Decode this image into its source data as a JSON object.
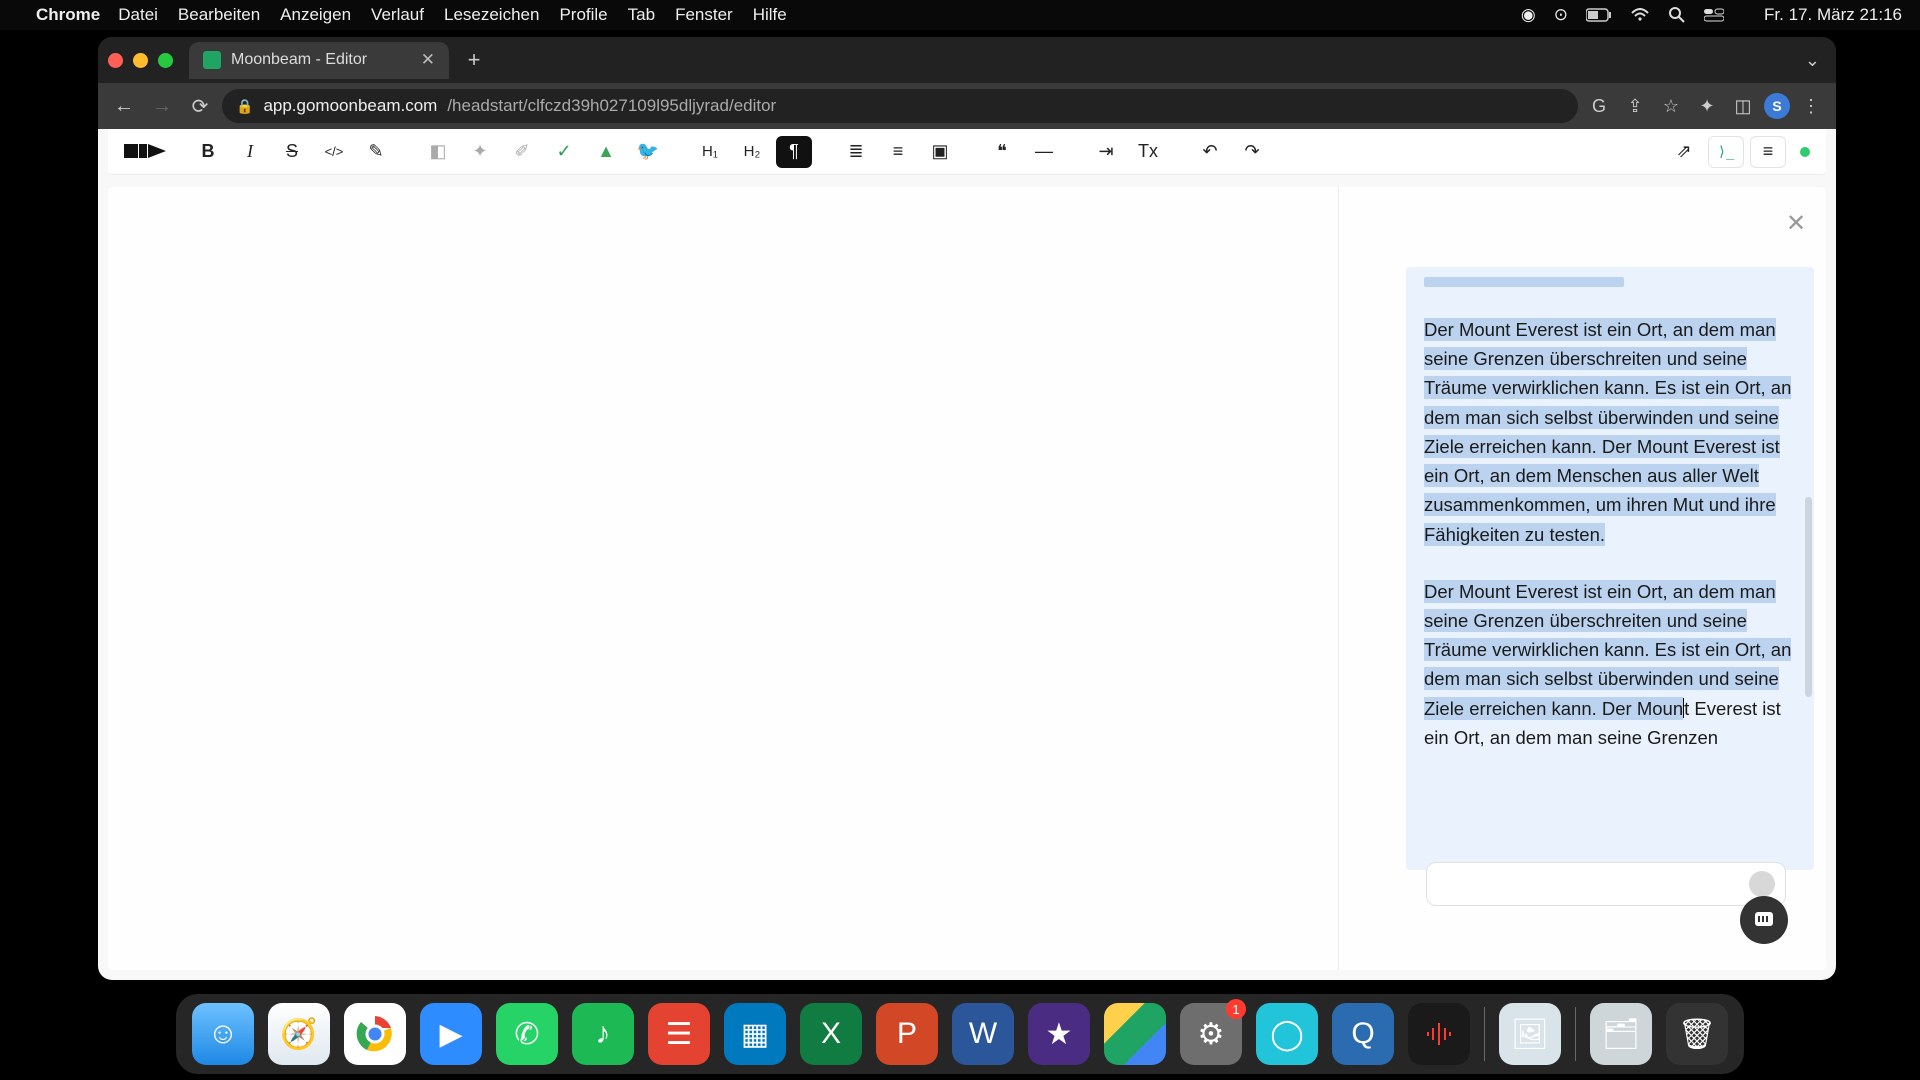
{
  "menubar": {
    "app_name": "Chrome",
    "items": [
      "Datei",
      "Bearbeiten",
      "Anzeigen",
      "Verlauf",
      "Lesezeichen",
      "Profile",
      "Tab",
      "Fenster",
      "Hilfe"
    ],
    "clock": "Fr. 17. März  21:16"
  },
  "browser": {
    "tab_title": "Moonbeam - Editor",
    "close_glyph": "✕",
    "newtab_glyph": "+",
    "chevron_glyph": "⌄",
    "nav": {
      "back": "←",
      "fwd": "→",
      "reload": "⟳"
    },
    "url_host": "app.gomoonbeam.com",
    "url_path": "/headstart/clfczd39h027109l95dljyrad/editor",
    "lock_glyph": "🔒",
    "avatar_initial": "S",
    "ext_glyphs": {
      "google": "G",
      "share": "⇪",
      "star": "☆",
      "puzzle": "✦",
      "panel": "◫",
      "menu": "⋮"
    }
  },
  "toolbar": {
    "bold": "B",
    "italic": "I",
    "strike": "S",
    "code": "</>",
    "highlight": "✎",
    "btn_a": "◧",
    "btn_b": "✦",
    "btn_c": "✐",
    "btn_check": "✓",
    "btn_flame": "▲",
    "btn_tw": "🐦",
    "h1": "H₁",
    "h2": "H₂",
    "para": "¶",
    "ul": "≣",
    "ol": "≡",
    "img": "▣",
    "quote": "❝",
    "hr": "—",
    "indent": "⇥",
    "clear": "Tx",
    "undo": "↶",
    "redo": "↷",
    "open": "⇗",
    "exec": "⟩_",
    "menu": "≡"
  },
  "panel": {
    "close": "✕",
    "para1_hl": "Der Mount Everest ist ein Ort, an dem man seine Grenzen überschreiten und seine Träume verwirklichen kann. Es ist ein Ort, an dem man sich selbst überwinden und seine Ziele erreichen kann. Der Mount Everest ist ein Ort, an dem Menschen aus aller Welt zusammenkommen, um ihren Mut und ihre Fähigkeiten zu testen.",
    "para2_hl": "Der Mount Everest ist ein Ort, an dem man seine Grenzen überschreiten und seine Träume verwirklichen kann. Es ist ein Ort, an dem man sich selbst überwinden und seine Ziele erreichen kann. Der Moun",
    "para2_rest": "t Everest ist ein Ort, an dem man seine Grenzen"
  },
  "dock": {
    "badge": "1"
  }
}
